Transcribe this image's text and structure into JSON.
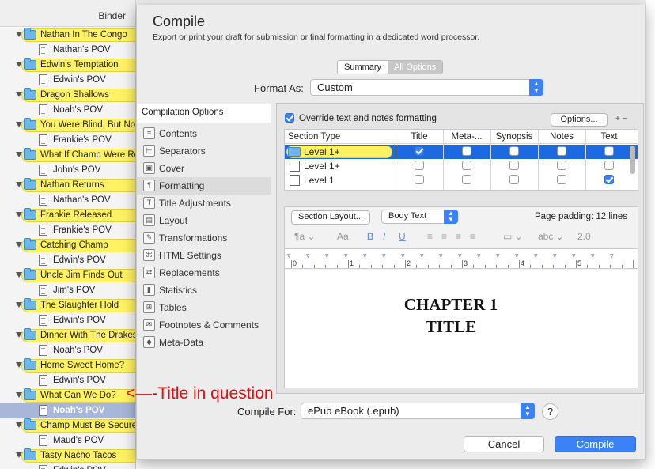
{
  "binder": {
    "title": "Binder",
    "rows": [
      {
        "label": "Nathan In The Congo",
        "level": "folder"
      },
      {
        "label": "Nathan's POV",
        "level": "doc"
      },
      {
        "label": "Edwin's Temptation",
        "level": "folder"
      },
      {
        "label": "Edwin's POV",
        "level": "doc"
      },
      {
        "label": "Dragon Shallows",
        "level": "folder"
      },
      {
        "label": "Noah's POV",
        "level": "doc"
      },
      {
        "label": "You Were Blind, But Not",
        "level": "folder"
      },
      {
        "label": "Frankie's POV",
        "level": "doc"
      },
      {
        "label": "What If Champ Were Re",
        "level": "folder"
      },
      {
        "label": "John's POV",
        "level": "doc"
      },
      {
        "label": "Nathan Returns",
        "level": "folder"
      },
      {
        "label": "Nathan's POV",
        "level": "doc"
      },
      {
        "label": "Frankie Released",
        "level": "folder"
      },
      {
        "label": "Frankie's POV",
        "level": "doc"
      },
      {
        "label": "Catching Champ",
        "level": "folder"
      },
      {
        "label": "Edwin's POV",
        "level": "doc"
      },
      {
        "label": "Uncle Jim Finds Out",
        "level": "folder"
      },
      {
        "label": "Jim's POV",
        "level": "doc"
      },
      {
        "label": "The Slaughter Hold",
        "level": "folder"
      },
      {
        "label": "Edwin's POV",
        "level": "doc"
      },
      {
        "label": "Dinner With The Drakes",
        "level": "folder"
      },
      {
        "label": "Noah's POV",
        "level": "doc"
      },
      {
        "label": "Home Sweet Home?",
        "level": "folder"
      },
      {
        "label": "Edwin's POV",
        "level": "doc"
      },
      {
        "label": "What Can We Do?",
        "level": "folder"
      },
      {
        "label": "Noah's POV",
        "level": "doc",
        "selected": true
      },
      {
        "label": "Champ Must Be Secured",
        "level": "folder"
      },
      {
        "label": "Maud's POV",
        "level": "doc"
      },
      {
        "label": "Tasty Nacho Tacos",
        "level": "folder"
      },
      {
        "label": "Edwin's POV",
        "level": "doc"
      }
    ]
  },
  "sheet": {
    "title": "Compile",
    "subtitle": "Export or print your draft for submission or final formatting in a dedicated word processor.",
    "tabs": [
      "Summary",
      "All Options"
    ],
    "format_label": "Format As:",
    "format_value": "Custom",
    "options_header": "Compilation Options",
    "options": [
      {
        "label": "Contents",
        "icon": "list-icon"
      },
      {
        "label": "Separators",
        "icon": "separator-icon"
      },
      {
        "label": "Cover",
        "icon": "cover-icon"
      },
      {
        "label": "Formatting",
        "icon": "formatting-icon",
        "selected": true
      },
      {
        "label": "Title Adjustments",
        "icon": "title-adjust-icon"
      },
      {
        "label": "Layout",
        "icon": "layout-icon"
      },
      {
        "label": "Transformations",
        "icon": "transform-icon"
      },
      {
        "label": "HTML Settings",
        "icon": "html-icon"
      },
      {
        "label": "Replacements",
        "icon": "replace-icon"
      },
      {
        "label": "Statistics",
        "icon": "stats-icon"
      },
      {
        "label": "Tables",
        "icon": "table-icon"
      },
      {
        "label": "Footnotes & Comments",
        "icon": "footnote-icon"
      },
      {
        "label": "Meta-Data",
        "icon": "tag-icon"
      }
    ],
    "override_label": "Override text and notes formatting",
    "override_checked": true,
    "options_button": "Options...",
    "plusminus": "+ −",
    "table": {
      "headers": [
        "Section Type",
        "Title",
        "Meta-...",
        "Synopsis",
        "Notes",
        "Text"
      ],
      "rows": [
        {
          "label": "Level  1+",
          "icon": "folder",
          "checks": [
            true,
            false,
            false,
            false,
            false
          ],
          "selected": true
        },
        {
          "label": "Level  1+",
          "icon": "doc",
          "checks": [
            false,
            false,
            false,
            false,
            false
          ]
        },
        {
          "label": "Level  1",
          "icon": "doc",
          "checks": [
            false,
            false,
            false,
            false,
            true
          ]
        }
      ]
    },
    "section_layout_button": "Section Layout...",
    "style_popup": "Body Text",
    "page_padding": "Page padding: 12 lines",
    "format_toolbar": [
      "¶a ⌄",
      "Aa",
      "B",
      "I",
      "U",
      "≡",
      "≡",
      "≡",
      "≡",
      "▭ ⌄",
      "abc ⌄",
      "2.0"
    ],
    "ruler_numbers": [
      "0",
      "1",
      "2",
      "3",
      "4",
      "5"
    ],
    "preview_text": [
      "CHAPTER 1",
      "TITLE"
    ],
    "compile_for_label": "Compile For:",
    "compile_for_value": "ePub eBook (.epub)",
    "help": "?",
    "cancel": "Cancel",
    "compile": "Compile"
  },
  "annotation": "<—-Title in question",
  "colors": {
    "accent": "#3b82f6",
    "highlight": "#fff363",
    "annotation": "#dd1111",
    "selected_row": "#1d6ae0"
  }
}
